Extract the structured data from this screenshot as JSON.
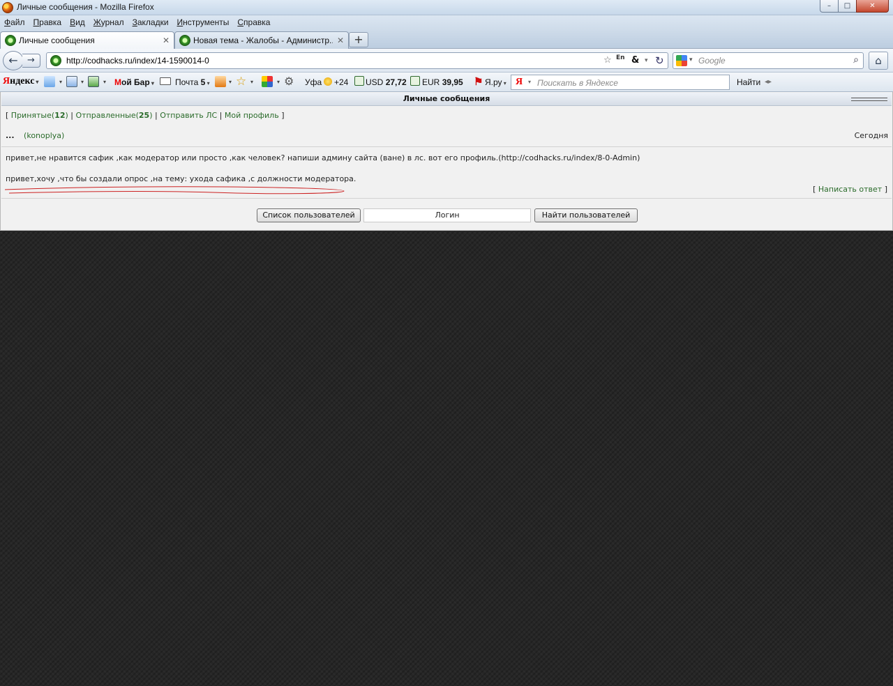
{
  "window": {
    "title": "Личные сообщения - Mozilla Firefox",
    "min": "–",
    "max": "□",
    "close": "✕"
  },
  "menu": [
    {
      "key": "Ф",
      "rest": "айл"
    },
    {
      "key": "П",
      "rest": "равка"
    },
    {
      "key": "В",
      "rest": "ид"
    },
    {
      "key": "Ж",
      "rest": "урнал"
    },
    {
      "key": "З",
      "rest": "акладки"
    },
    {
      "key": "И",
      "rest": "нструменты"
    },
    {
      "key": "С",
      "rest": "правка"
    }
  ],
  "tabs": [
    {
      "label": "Личные сообщения",
      "close": "✕"
    },
    {
      "label": "Новая тема - Жалобы - Администр...",
      "close": "✕"
    },
    {
      "new": "+"
    }
  ],
  "nav": {
    "url": "http://codhacks.ru/index/14-1590014-0",
    "search_placeholder": "Google",
    "lang_label": "En",
    "amp": "&"
  },
  "yandex_bar": {
    "logo_red": "Я",
    "logo_rest": "ндекс",
    "my_bar_red": "М",
    "my_bar_rest": "ой Бар",
    "mail_label": "Почта",
    "mail_count": "5",
    "city": "Уфа",
    "temp": "+24",
    "usd_label": "USD",
    "usd_value": "27,72",
    "eur_label": "EUR",
    "eur_value": "39,95",
    "yaru": "Я.ру",
    "search_placeholder": "Поискать в Яндексе",
    "find_label": "Найти"
  },
  "page": {
    "header_title": "Личные сообщения",
    "nav_links": {
      "inbox_label": "Принятые",
      "inbox_count": "12",
      "sent_label": "Отправленные",
      "sent_count": "25",
      "send_label": "Отправить ЛС",
      "profile_label": "Мой профиль"
    },
    "message": {
      "dots": "...",
      "sender": "(konoplya)",
      "date": "Сегодня",
      "line1": "привет,не нравится сафик ,как модератор или просто ,как человек? напиши админу сайта (ване) в лс. вот его профиль.(http://codhacks.ru/index/8-0-Admin)",
      "line2": "привет,хочу ,что бы создали опрос ,на тему: ухода сафика ,с должности модератора.",
      "reply_label": "Написать ответ"
    },
    "buttons": {
      "users_list": "Список пользователей",
      "login_value": "Логин",
      "find_users": "Найти пользователей"
    }
  },
  "colors": {
    "link": "#2a6b2a",
    "scribble": "#cc2222",
    "background": "#262626"
  }
}
